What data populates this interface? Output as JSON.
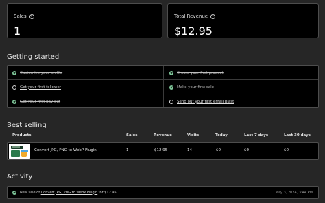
{
  "stats": [
    {
      "label": "Sales",
      "value": "1"
    },
    {
      "label": "Total Revenue",
      "value": "$12.95"
    }
  ],
  "getting_started": {
    "title": "Getting started",
    "items": [
      {
        "label": "Customize your profile",
        "done": true
      },
      {
        "label": "Create your first product",
        "done": true
      },
      {
        "label": "Get your first follower",
        "done": false
      },
      {
        "label": "Make your first sale",
        "done": true
      },
      {
        "label": "Get your first pay out",
        "done": true
      },
      {
        "label": "Send out your first email blast",
        "done": false
      }
    ]
  },
  "best_selling": {
    "title": "Best selling",
    "columns": [
      "Products",
      "Sales",
      "Revenue",
      "Visits",
      "Today",
      "Last 7 days",
      "Last 30 days"
    ],
    "rows": [
      {
        "product": "Convert JPG, PNG to WebP Plugin",
        "sales": "1",
        "revenue": "$12.95",
        "visits": "14",
        "today": "$0",
        "last7": "$0",
        "last30": "$0"
      }
    ]
  },
  "activity": {
    "title": "Activity",
    "items": [
      {
        "prefix": "New sale of",
        "link": "Convert JPG, PNG to WebP Plugin",
        "suffix": "for $12.95",
        "time": "May 3, 2024, 3:44 PM"
      }
    ]
  },
  "colors": {
    "background": "#262626",
    "card": "#000000",
    "border": "#4d4d4d",
    "check_green": "#7fc79a"
  }
}
